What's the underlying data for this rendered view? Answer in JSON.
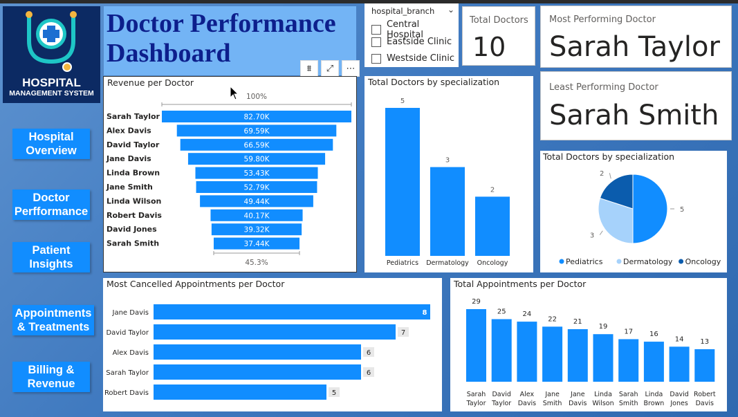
{
  "logo": {
    "line1": "HOSPITAL",
    "line2": "MANAGEMENT SYSTEM"
  },
  "title": "Doctor Performance\nDashboard",
  "nav": [
    {
      "label": "Hospital\nOverview"
    },
    {
      "label": "Doctor\nPerfformance"
    },
    {
      "label": "Patient\nInsights"
    },
    {
      "label": "Appointments\n& Treatments"
    },
    {
      "label": "Billing &\nRevenue"
    }
  ],
  "slicer": {
    "title": "hospital_branch",
    "items": [
      "Central Hospital",
      "Eastside Clinic",
      "Westside Clinic"
    ]
  },
  "kpi": {
    "total_doctors_label": "Total Doctors",
    "total_doctors_value": "10",
    "most_label": "Most Performing Doctor",
    "most_value": "Sarah Taylor",
    "least_label": "Least Performing Doctor",
    "least_value": "Sarah Smith"
  },
  "colors": {
    "bar": "#118dff",
    "pediatrics": "#118dff",
    "dermatology": "#a6d2fb",
    "oncology": "#0b5cad"
  },
  "chart_data": [
    {
      "type": "bar",
      "orientation": "funnel",
      "title": "Revenue per Doctor",
      "categories": [
        "Sarah Taylor",
        "Alex Davis",
        "David Taylor",
        "Jane Davis",
        "Linda Brown",
        "Jane Smith",
        "Linda Wilson",
        "Robert Davis",
        "David Jones",
        "Sarah Smith"
      ],
      "values": [
        82.7,
        69.59,
        66.59,
        59.8,
        53.43,
        52.79,
        49.44,
        40.17,
        39.32,
        37.44
      ],
      "labels": [
        "82.70K",
        "69.59K",
        "66.59K",
        "59.80K",
        "53.43K",
        "52.79K",
        "49.44K",
        "40.17K",
        "39.32K",
        "37.44K"
      ],
      "top_pct": "100%",
      "bottom_pct": "45.3%"
    },
    {
      "type": "bar",
      "title": "Total Doctors by specialization",
      "categories": [
        "Pediatrics",
        "Dermatology",
        "Oncology"
      ],
      "values": [
        5,
        3,
        2
      ]
    },
    {
      "type": "pie",
      "title": "Total Doctors by specialization",
      "categories": [
        "Pediatrics",
        "Dermatology",
        "Oncology"
      ],
      "values": [
        5,
        3,
        2
      ],
      "legend": "bottom"
    },
    {
      "type": "bar",
      "orientation": "horizontal",
      "title": "Most Cancelled Appointments per Doctor",
      "categories": [
        "Jane Davis",
        "David Taylor",
        "Alex Davis",
        "Sarah Taylor",
        "Robert Davis"
      ],
      "values": [
        8,
        7,
        6,
        6,
        5
      ]
    },
    {
      "type": "bar",
      "title": "Total Appointments per Doctor",
      "categories": [
        "Sarah Taylor",
        "David Taylor",
        "Alex Davis",
        "Jane Smith",
        "Jane Davis",
        "Linda Wilson",
        "Sarah Smith",
        "Linda Brown",
        "David Jones",
        "Robert Davis"
      ],
      "values": [
        29,
        25,
        24,
        22,
        21,
        19,
        17,
        16,
        14,
        13
      ]
    }
  ]
}
